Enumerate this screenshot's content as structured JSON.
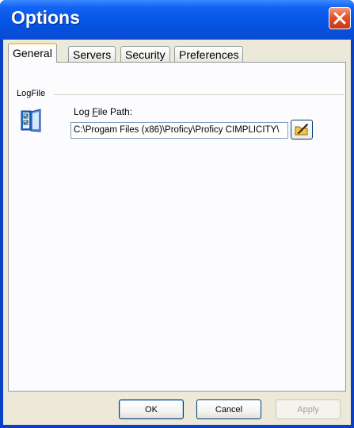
{
  "window": {
    "title": "Options"
  },
  "tabs": [
    {
      "label": "General",
      "active": true
    },
    {
      "label": "Servers",
      "active": false
    },
    {
      "label": "Security",
      "active": false
    },
    {
      "label": "Preferences",
      "active": false
    }
  ],
  "general": {
    "group_label": "LogFile",
    "field_label_prefix": "Log ",
    "field_label_mnemonic": "F",
    "field_label_suffix": "ile Path:",
    "log_file_path": "C:\\Progam Files (x86)\\Proficy\\Proficy CIMPLICITY\\",
    "icon": "logfile-icon",
    "browse_icon": "browse-folder-icon"
  },
  "buttons": {
    "ok": "OK",
    "cancel": "Cancel",
    "apply": "Apply"
  },
  "colors": {
    "title_bar": "#0757e8",
    "dialog_bg": "#ece9d8",
    "tab_highlight": "#ffc83c",
    "close_button": "#e3502a"
  }
}
